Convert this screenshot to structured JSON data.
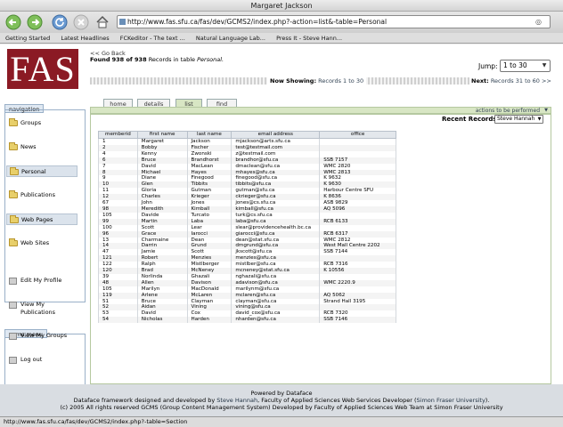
{
  "window": {
    "title": "Margaret Jackson"
  },
  "toolbar": {
    "url": "http://www.fas.sfu.ca/fas/dev/GCMS2/index.php?-action=list&-table=Personal"
  },
  "bookmarks": [
    "Getting Started",
    "Latest Headlines",
    "FCKeditor - The text ...",
    "Natural Language Lab...",
    "Press It - Steve Hann..."
  ],
  "header": {
    "logo_text": "FAS",
    "go_back": "<< Go Back",
    "found_prefix": "Found",
    "found_count": "938 of 938",
    "found_mid": "Records in table",
    "found_table": "Personal."
  },
  "jump": {
    "label": "Jump:",
    "selected": "1 to 30"
  },
  "showing": {
    "label": "Now Showing:",
    "value": "Records 1 to 30",
    "next_label": "Next:",
    "next_value": "Records 31 to 60",
    "next_arrows": ">>"
  },
  "navigation": {
    "title": "navigation",
    "items": [
      "Groups",
      "News",
      "Personal",
      "Publications",
      "Web Pages",
      "Web Sites"
    ]
  },
  "menu": {
    "title": "gcms menu",
    "items": [
      "Edit My Profile",
      "View My Publications",
      "View My Groups",
      "Log out"
    ]
  },
  "tabs": [
    "home",
    "details",
    "list",
    "find"
  ],
  "actions_label": "actions to be performed",
  "recent": {
    "label": "Recent Records:",
    "selected": "Steve Hannah"
  },
  "table": {
    "headers": [
      "memberid",
      "first name",
      "last name",
      "email address",
      "office"
    ],
    "rows": [
      [
        "1",
        "Margaret",
        "Jackson",
        "mjackson@arts.sfu.ca",
        ""
      ],
      [
        "2",
        "Bobby",
        "Fischer",
        "test@testmail.com",
        ""
      ],
      [
        "4",
        "Kenny",
        "Zwonski",
        "z@testmail.com",
        ""
      ],
      [
        "6",
        "Bruce",
        "Brandhorst",
        "brandhor@sfu.ca",
        "SSB 7157"
      ],
      [
        "7",
        "David",
        "MacLean",
        "dmaclean@sfu.ca",
        "WMC 2820"
      ],
      [
        "8",
        "Michael",
        "Hayes",
        "mhayes@sfu.ca",
        "WMC 2813"
      ],
      [
        "9",
        "Diane",
        "Finegood",
        "finegood@sfu.ca",
        "K 9632"
      ],
      [
        "10",
        "Glen",
        "Tibbits",
        "tibbits@sfu.ca",
        "K 9630"
      ],
      [
        "11",
        "Gloria",
        "Gutman",
        "gutman@sfu.ca",
        "Harbour Centre SFU"
      ],
      [
        "12",
        "Charles",
        "Krieger",
        "ckrieger@sfu.ca",
        "K 8636"
      ],
      [
        "67",
        "John",
        "Jones",
        "jones@cs.sfu.ca",
        "ASB 9829"
      ],
      [
        "98",
        "Meredith",
        "Kimball",
        "kimball@sfu.ca",
        "AQ 5096"
      ],
      [
        "105",
        "Davide",
        "Turcato",
        "turk@cs.sfu.ca",
        ""
      ],
      [
        "99",
        "Martin",
        "Laba",
        "laba@sfu.ca",
        "RCB 6133"
      ],
      [
        "100",
        "Scott",
        "Lear",
        "slear@providencehealth.bc.ca",
        ""
      ],
      [
        "96",
        "Grace",
        "Iarocci",
        "giarocci@sfu.ca",
        "RCB 6317"
      ],
      [
        "13",
        "Charmaine",
        "Dean",
        "dean@stat.sfu.ca",
        "WMC 2812"
      ],
      [
        "14",
        "Darrin",
        "Grund",
        "dmgrund@sfu.ca",
        "West Mall Centre 2202"
      ],
      [
        "47",
        "Jamie",
        "Scott",
        "jkscott@sfu.ca",
        "SSB 7144"
      ],
      [
        "121",
        "Robert",
        "Menzies",
        "menzies@sfu.ca",
        ""
      ],
      [
        "122",
        "Ralph",
        "Mistlberger",
        "mistlber@sfu.ca",
        "RCB 7316"
      ],
      [
        "120",
        "Brad",
        "McNeney",
        "mcneney@stat.sfu.ca",
        "K 10556"
      ],
      [
        "39",
        "Norlinda",
        "Ghazali",
        "nghazali@sfu.ca",
        ""
      ],
      [
        "48",
        "Allen",
        "Davison",
        "adavison@sfu.ca",
        "WMC 2220.9"
      ],
      [
        "105",
        "Marilyn",
        "MacDonald",
        "marilynm@sfu.ca",
        ""
      ],
      [
        "119",
        "Arlene",
        "McLaren",
        "mclaren@sfu.ca",
        "AQ 5062"
      ],
      [
        "51",
        "Bruce",
        "Clayman",
        "clayman@sfu.ca",
        "Strand Hall 3195"
      ],
      [
        "52",
        "Aidan",
        "Vining",
        "vining@sfu.ca",
        ""
      ],
      [
        "53",
        "David",
        "Cox",
        "david_cox@sfu.ca",
        "RCB 7320"
      ],
      [
        "54",
        "Nicholas",
        "Harden",
        "nharden@sfu.ca",
        "SSB 7146"
      ]
    ]
  },
  "footer": {
    "powered": "Powered by Dataface",
    "line2_a": "Dataface framework designed and developed by",
    "line2_name": "Steve Hannah",
    "line2_b": ", Faculty of Applied Sciences Web Services Developer (",
    "line2_uni": "Simon Fraser University",
    "line2_c": ").",
    "line3": "(c) 2005 All rights reserved GCMS (Group Content Management System) Developed by Faculty of Applied Sciences Web Team at Simon Fraser University"
  },
  "status": {
    "text": "http://www.fas.sfu.ca/fas/dev/GCMS2/index.php?-table=Section"
  },
  "colors": {
    "logo_bg": "#8b1a24",
    "active_tab": "#d8e6c4",
    "nav_border": "#9ab0c8",
    "footer_bg": "#d9dde2"
  }
}
